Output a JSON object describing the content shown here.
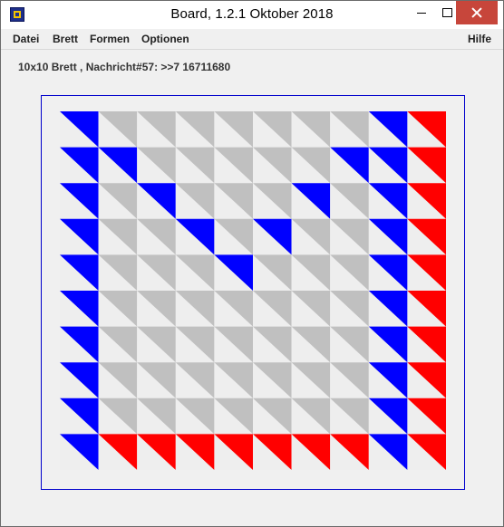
{
  "window": {
    "title": "Board, 1.2.1 Oktober 2018",
    "icon": "board-app-icon"
  },
  "menu": {
    "left": [
      "Datei",
      "Brett",
      "Formen",
      "Optionen"
    ],
    "help": "Hilfe"
  },
  "status_text": "10x10 Brett , Nachricht#57: >>7 16711680",
  "board": {
    "rows": 10,
    "cols": 10,
    "colors": {
      "B": "#0000ff",
      "R": "#ff0000",
      "G": "#c0c0c0",
      "background": "#eeeeee",
      "frame": "#0000cc"
    },
    "cells": [
      [
        "B",
        "G",
        "G",
        "G",
        "G",
        "G",
        "G",
        "G",
        "B",
        "R"
      ],
      [
        "B",
        "B",
        "G",
        "G",
        "G",
        "G",
        "G",
        "B",
        "B",
        "R"
      ],
      [
        "B",
        "G",
        "B",
        "G",
        "G",
        "G",
        "B",
        "G",
        "B",
        "R"
      ],
      [
        "B",
        "G",
        "G",
        "B",
        "G",
        "B",
        "G",
        "G",
        "B",
        "R"
      ],
      [
        "B",
        "G",
        "G",
        "G",
        "B",
        "G",
        "G",
        "G",
        "B",
        "R"
      ],
      [
        "B",
        "G",
        "G",
        "G",
        "G",
        "G",
        "G",
        "G",
        "B",
        "R"
      ],
      [
        "B",
        "G",
        "G",
        "G",
        "G",
        "G",
        "G",
        "G",
        "B",
        "R"
      ],
      [
        "B",
        "G",
        "G",
        "G",
        "G",
        "G",
        "G",
        "G",
        "B",
        "R"
      ],
      [
        "B",
        "G",
        "G",
        "G",
        "G",
        "G",
        "G",
        "G",
        "B",
        "R"
      ],
      [
        "B",
        "R",
        "R",
        "R",
        "R",
        "R",
        "R",
        "R",
        "B",
        "R"
      ]
    ]
  }
}
